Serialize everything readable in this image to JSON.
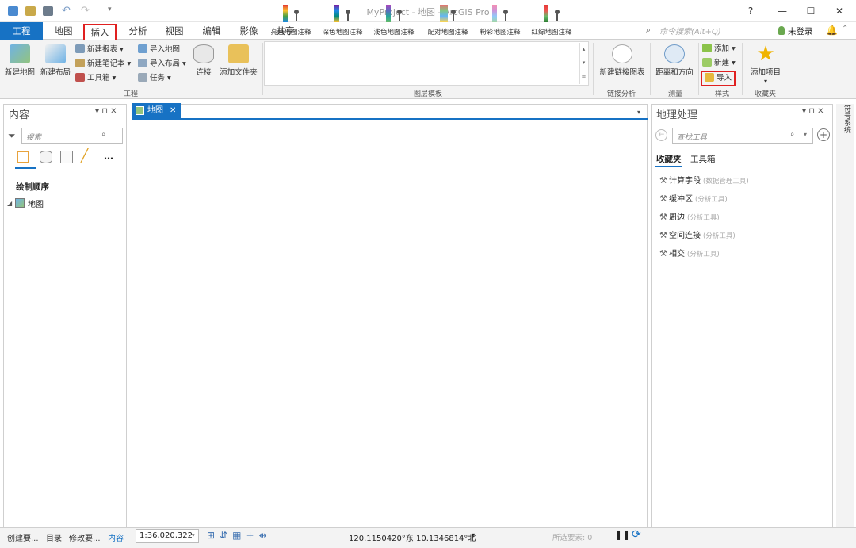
{
  "window": {
    "title": "MyProject - 地图 - ArcGIS Pro",
    "help": "?",
    "minimize": "—",
    "maximize": "☐",
    "close": "✕"
  },
  "tabs": [
    "工程",
    "地图",
    "插入",
    "分析",
    "视图",
    "编辑",
    "影像",
    "共享"
  ],
  "command_search": {
    "placeholder": "命令搜索(Alt+Q)"
  },
  "account": {
    "label": "未登录",
    "arrow": "▾"
  },
  "ribbon": {
    "project": {
      "new_map": "新建地图",
      "new_layout": "新建布局",
      "new_report": "新建报表",
      "new_notebook": "新建笔记本",
      "toolbox": "工具箱",
      "import_map": "导入地图",
      "import_layout": "导入布局",
      "task": "任务",
      "connect": "连接",
      "add_folder": "添加文件夹",
      "group": "工程"
    },
    "layer_templates": {
      "items": [
        "亮色地图注释",
        "深色地图注释",
        "浅色地图注释",
        "配对地图注释",
        "粉彩地图注释",
        "红绿地图注释"
      ],
      "group": "图层模板"
    },
    "link_analysis": {
      "new_link_chart": "新建链接图表",
      "group": "链接分析"
    },
    "measure": {
      "distance_direction": "距离和方向",
      "group": "测量"
    },
    "styles": {
      "add": "添加",
      "new": "新建",
      "import": "导入",
      "group": "样式"
    },
    "favorites": {
      "add_item": "添加项目",
      "group": "收藏夹"
    }
  },
  "contents": {
    "title": "内容",
    "search": "搜索",
    "heading": "绘制顺序",
    "layer": "地图",
    "more": "…"
  },
  "map": {
    "tab": "地图",
    "close": "✕"
  },
  "geoprocessing": {
    "title": "地理处理",
    "search": "查找工具",
    "tabs": [
      "收藏夹",
      "工具箱"
    ],
    "tools": [
      {
        "name": "计算字段",
        "cat": "(数据管理工具)"
      },
      {
        "name": "缓冲区",
        "cat": "(分析工具)"
      },
      {
        "name": "周边",
        "cat": "(分析工具)"
      },
      {
        "name": "空间连接",
        "cat": "(分析工具)"
      },
      {
        "name": "相交",
        "cat": "(分析工具)"
      }
    ]
  },
  "side_tab": "符号系统",
  "bottom_tabs": [
    "创建要...",
    "目录",
    "修改要...",
    "内容"
  ],
  "status": {
    "scale": "1:36,020,322",
    "coords": "120.1150420°东 10.1346814°北",
    "selected": "所选要素: 0"
  }
}
